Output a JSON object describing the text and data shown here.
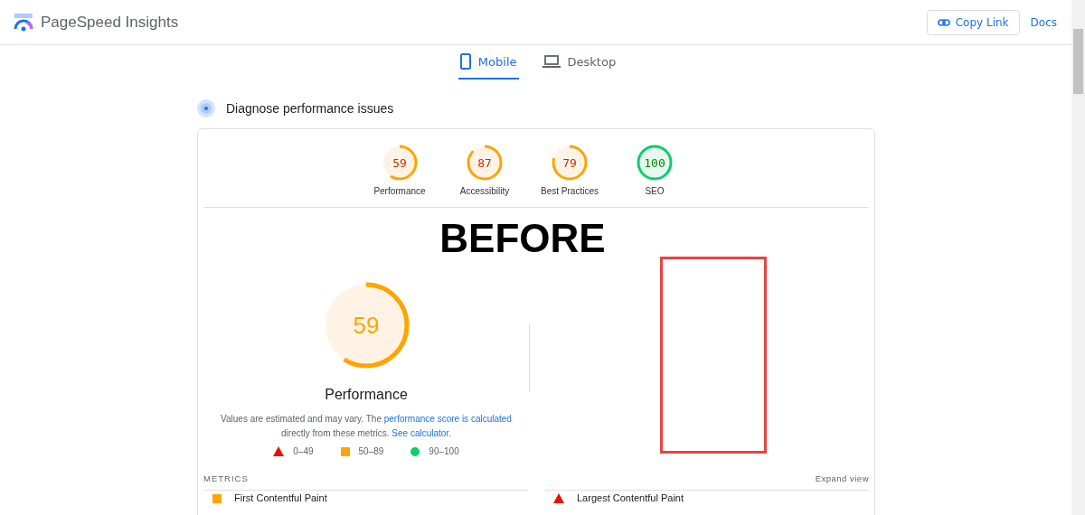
{
  "header": {
    "title": "PageSpeed Insights",
    "copy_link": "Copy Link",
    "docs": "Docs"
  },
  "tabs": [
    {
      "label": "Mobile",
      "kind": "phone",
      "selected": true
    },
    {
      "label": "Desktop",
      "kind": "laptop",
      "selected": false
    }
  ],
  "section_title": "Diagnose performance issues",
  "categories": [
    {
      "score": "59",
      "label": "Performance",
      "kind": "average"
    },
    {
      "score": "87",
      "label": "Accessibility",
      "kind": "average"
    },
    {
      "score": "79",
      "label": "Best Practices",
      "kind": "average"
    },
    {
      "score": "100",
      "label": "SEO",
      "kind": "pass"
    }
  ],
  "annotation": {
    "text": "BEFORE"
  },
  "overall": {
    "score": "59",
    "label": "Performance",
    "kind": "average",
    "description": [
      {
        "kind": "text",
        "text": "Values are estimated and may vary. The "
      },
      {
        "kind": "link",
        "text": "performance score is calculated"
      },
      {
        "kind": "text",
        "text": " directly from these metrics. "
      },
      {
        "kind": "link",
        "text": "See calculator."
      }
    ]
  },
  "legend": [
    {
      "kind": "fail",
      "text": "0–49"
    },
    {
      "kind": "average",
      "text": "50–89"
    },
    {
      "kind": "pass",
      "text": "90–100"
    }
  ],
  "metrics": {
    "title": "METRICS",
    "expand": "Expand view",
    "items": [
      {
        "label": "First Contentful Paint",
        "kind": "average"
      },
      {
        "label": "Largest Contentful Paint",
        "kind": "fail"
      }
    ]
  }
}
